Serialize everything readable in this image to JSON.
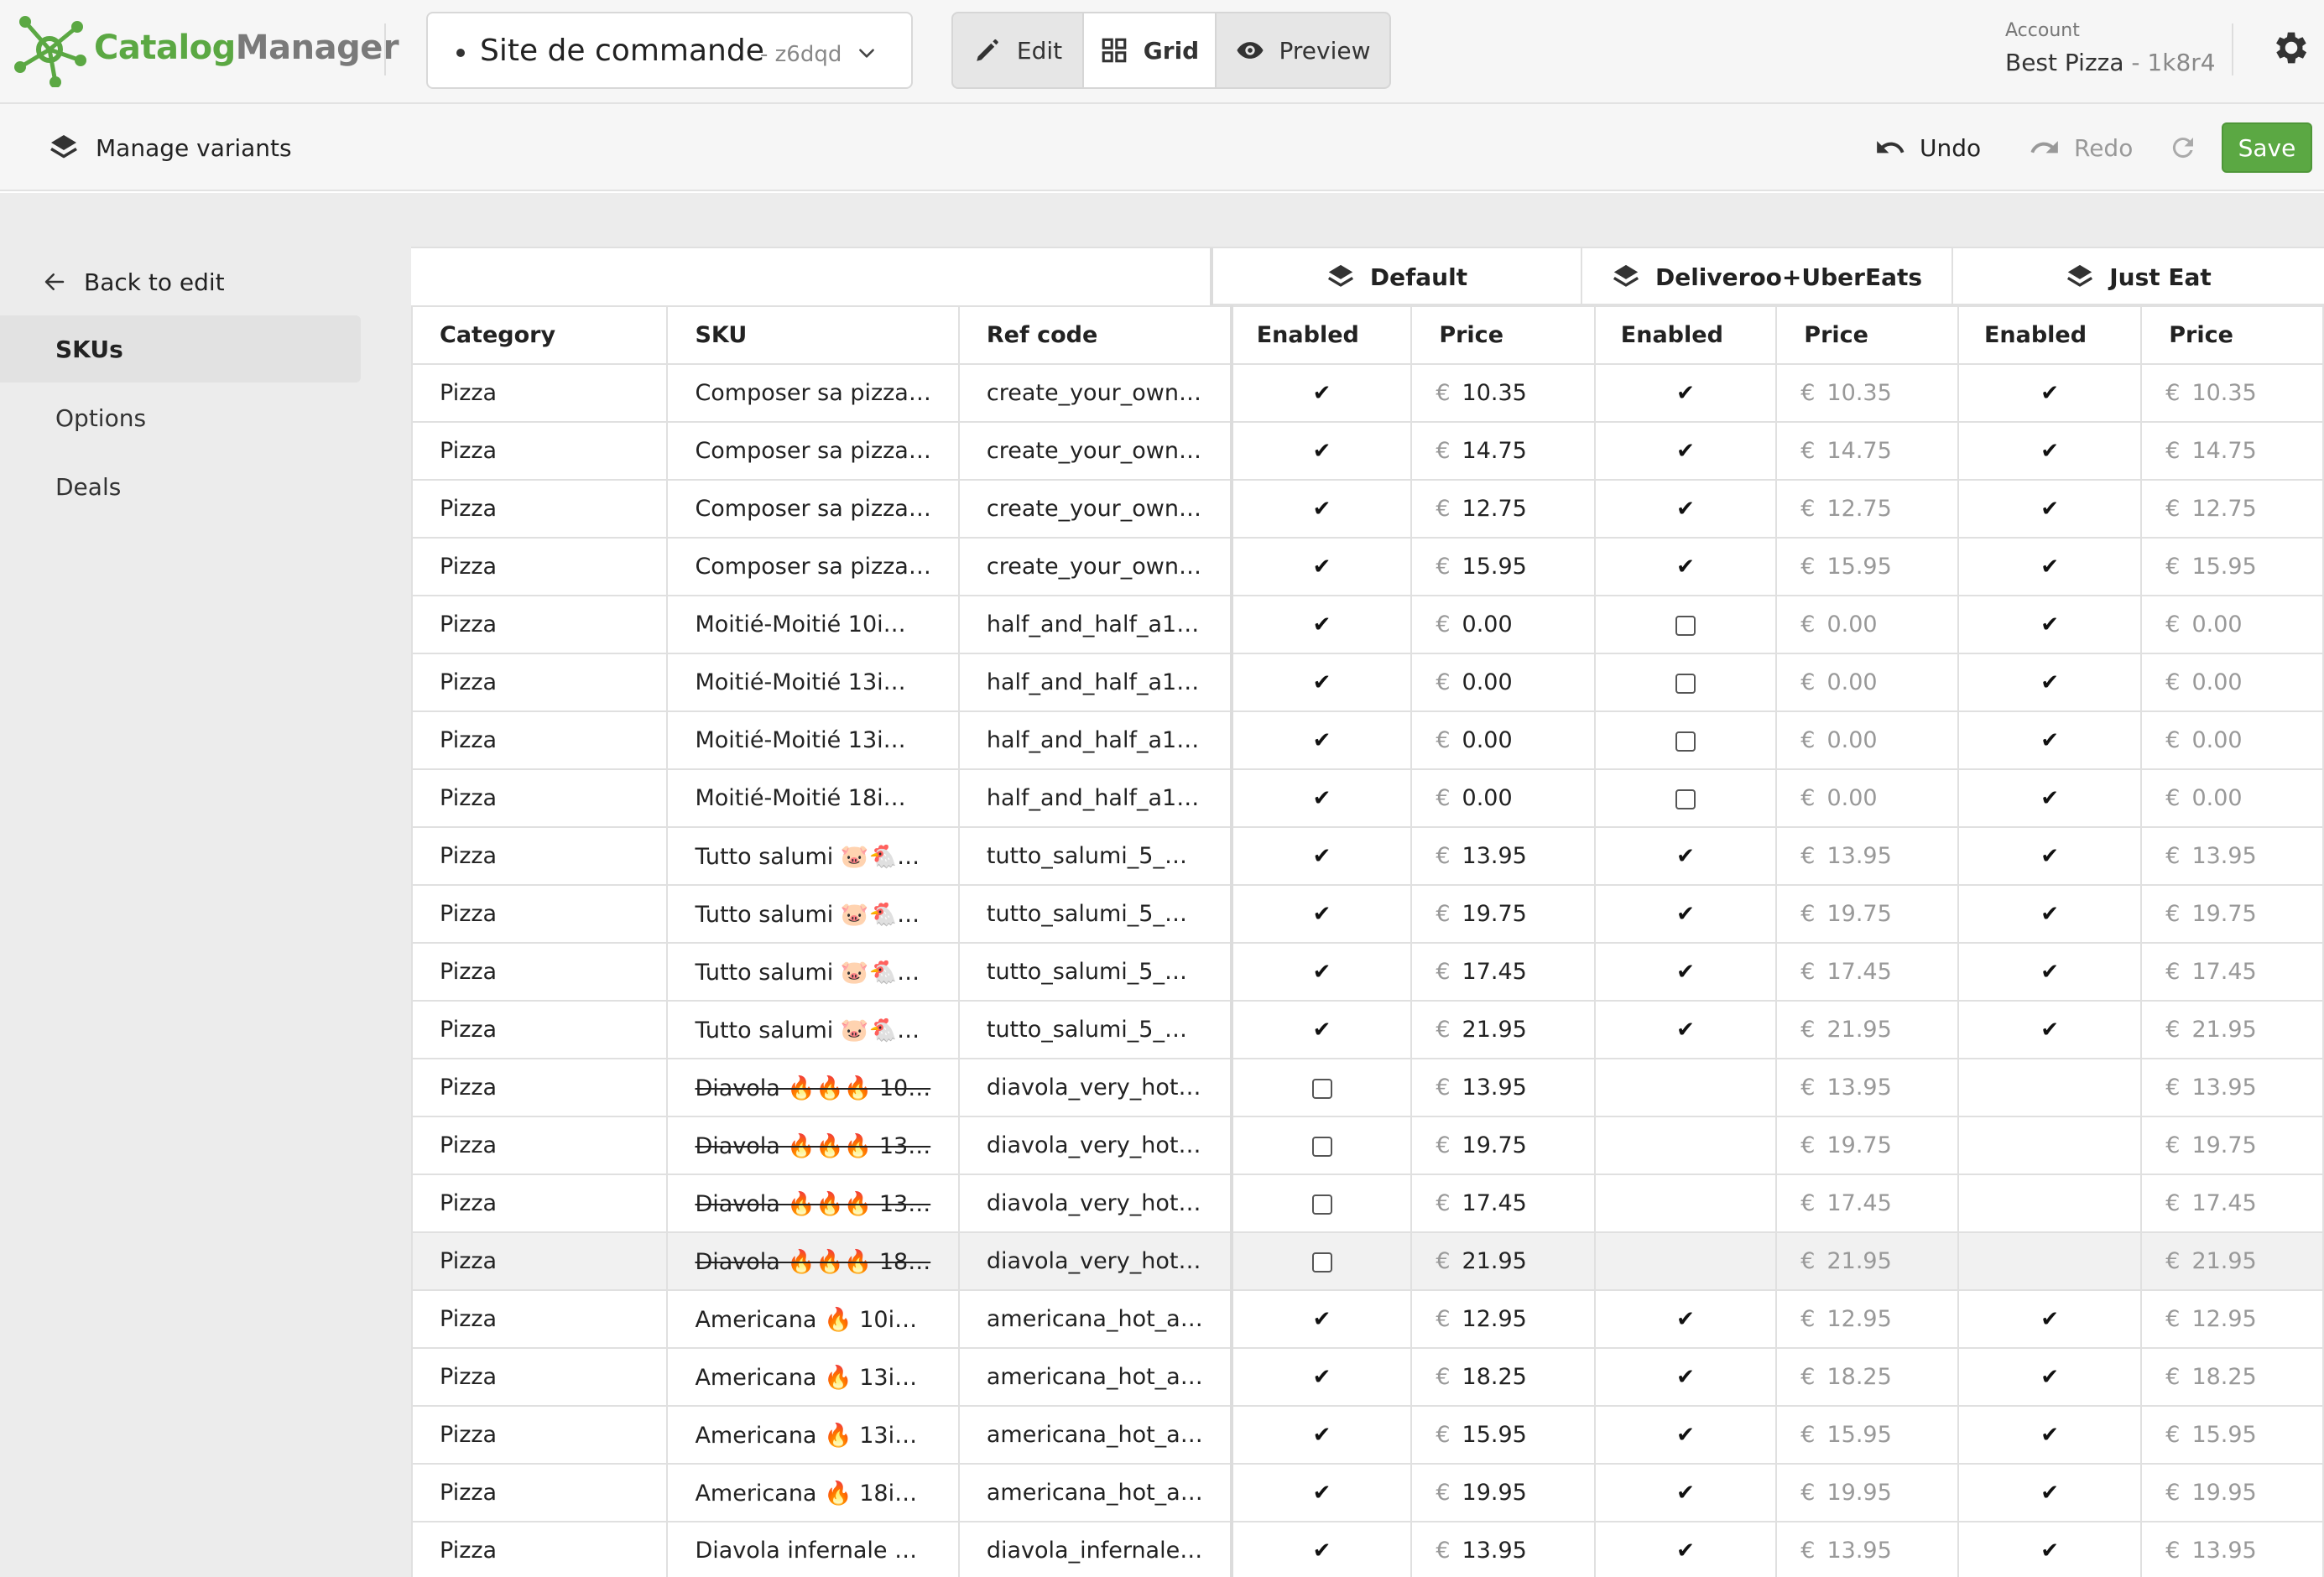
{
  "brand": {
    "part1": "Catalog",
    "part2": "Manager"
  },
  "site": {
    "name": "Site de commande",
    "code": "- z6dqd"
  },
  "modes": {
    "edit": "Edit",
    "grid": "Grid",
    "preview": "Preview"
  },
  "account": {
    "label": "Account",
    "name": "Best Pizza",
    "code": "- 1k8r4"
  },
  "toolbar": {
    "manage_variants": "Manage variants",
    "undo": "Undo",
    "redo": "Redo",
    "save": "Save"
  },
  "sidenav": {
    "back": "Back to edit",
    "items": [
      "SKUs",
      "Options",
      "Deals"
    ]
  },
  "variants": [
    "Default",
    "Deliveroo+UberEats",
    "Just Eat"
  ],
  "columns": {
    "category": "Category",
    "sku": "SKU",
    "ref": "Ref code",
    "enabled": "Enabled",
    "price": "Price"
  },
  "currency": "€",
  "colors": {
    "accent": "#5ba843",
    "muted": "#999999"
  },
  "rows": [
    {
      "category": "Pizza",
      "sku": "Composer sa pizza…",
      "ref": "create_your_own…",
      "strike": false,
      "d_en": "check",
      "d_price": "10.35",
      "u_en": "check",
      "u_price": "10.35",
      "j_en": "check",
      "j_price": "10.35"
    },
    {
      "category": "Pizza",
      "sku": "Composer sa pizza…",
      "ref": "create_your_own…",
      "strike": false,
      "d_en": "check",
      "d_price": "14.75",
      "u_en": "check",
      "u_price": "14.75",
      "j_en": "check",
      "j_price": "14.75"
    },
    {
      "category": "Pizza",
      "sku": "Composer sa pizza…",
      "ref": "create_your_own…",
      "strike": false,
      "d_en": "check",
      "d_price": "12.75",
      "u_en": "check",
      "u_price": "12.75",
      "j_en": "check",
      "j_price": "12.75"
    },
    {
      "category": "Pizza",
      "sku": "Composer sa pizza…",
      "ref": "create_your_own…",
      "strike": false,
      "d_en": "check",
      "d_price": "15.95",
      "u_en": "check",
      "u_price": "15.95",
      "j_en": "check",
      "j_price": "15.95"
    },
    {
      "category": "Pizza",
      "sku": "Moitié-Moitié 10i…",
      "ref": "half_and_half_a1…",
      "strike": false,
      "d_en": "check",
      "d_price": "0.00",
      "u_en": "box",
      "u_price": "0.00",
      "j_en": "check",
      "j_price": "0.00"
    },
    {
      "category": "Pizza",
      "sku": "Moitié-Moitié 13i…",
      "ref": "half_and_half_a1…",
      "strike": false,
      "d_en": "check",
      "d_price": "0.00",
      "u_en": "box",
      "u_price": "0.00",
      "j_en": "check",
      "j_price": "0.00"
    },
    {
      "category": "Pizza",
      "sku": "Moitié-Moitié 13i…",
      "ref": "half_and_half_a1…",
      "strike": false,
      "d_en": "check",
      "d_price": "0.00",
      "u_en": "box",
      "u_price": "0.00",
      "j_en": "check",
      "j_price": "0.00"
    },
    {
      "category": "Pizza",
      "sku": "Moitié-Moitié 18i…",
      "ref": "half_and_half_a1…",
      "strike": false,
      "d_en": "check",
      "d_price": "0.00",
      "u_en": "box",
      "u_price": "0.00",
      "j_en": "check",
      "j_price": "0.00"
    },
    {
      "category": "Pizza",
      "sku": "Tutto salumi 🐷🐔…",
      "ref": "tutto_salumi_5_…",
      "strike": false,
      "d_en": "check",
      "d_price": "13.95",
      "u_en": "check",
      "u_price": "13.95",
      "j_en": "check",
      "j_price": "13.95"
    },
    {
      "category": "Pizza",
      "sku": "Tutto salumi 🐷🐔…",
      "ref": "tutto_salumi_5_…",
      "strike": false,
      "d_en": "check",
      "d_price": "19.75",
      "u_en": "check",
      "u_price": "19.75",
      "j_en": "check",
      "j_price": "19.75"
    },
    {
      "category": "Pizza",
      "sku": "Tutto salumi 🐷🐔…",
      "ref": "tutto_salumi_5_…",
      "strike": false,
      "d_en": "check",
      "d_price": "17.45",
      "u_en": "check",
      "u_price": "17.45",
      "j_en": "check",
      "j_price": "17.45"
    },
    {
      "category": "Pizza",
      "sku": "Tutto salumi 🐷🐔…",
      "ref": "tutto_salumi_5_…",
      "strike": false,
      "d_en": "check",
      "d_price": "21.95",
      "u_en": "check",
      "u_price": "21.95",
      "j_en": "check",
      "j_price": "21.95"
    },
    {
      "category": "Pizza",
      "sku": "Diavola 🔥🔥🔥 10…",
      "ref": "diavola_very_hot…",
      "strike": true,
      "d_en": "box",
      "d_price": "13.95",
      "u_en": "",
      "u_price": "13.95",
      "j_en": "",
      "j_price": "13.95"
    },
    {
      "category": "Pizza",
      "sku": "Diavola 🔥🔥🔥 13…",
      "ref": "diavola_very_hot…",
      "strike": true,
      "d_en": "box",
      "d_price": "19.75",
      "u_en": "",
      "u_price": "19.75",
      "j_en": "",
      "j_price": "19.75"
    },
    {
      "category": "Pizza",
      "sku": "Diavola 🔥🔥🔥 13…",
      "ref": "diavola_very_hot…",
      "strike": true,
      "d_en": "box",
      "d_price": "17.45",
      "u_en": "",
      "u_price": "17.45",
      "j_en": "",
      "j_price": "17.45"
    },
    {
      "category": "Pizza",
      "sku": "Diavola 🔥🔥🔥 18…",
      "ref": "diavola_very_hot…",
      "strike": true,
      "d_en": "box",
      "d_price": "21.95",
      "u_en": "",
      "u_price": "21.95",
      "j_en": "",
      "j_price": "21.95",
      "hover": true
    },
    {
      "category": "Pizza",
      "sku": "Americana 🔥 10i…",
      "ref": "americana_hot_a…",
      "strike": false,
      "d_en": "check",
      "d_price": "12.95",
      "u_en": "check",
      "u_price": "12.95",
      "j_en": "check",
      "j_price": "12.95"
    },
    {
      "category": "Pizza",
      "sku": "Americana 🔥 13i…",
      "ref": "americana_hot_a…",
      "strike": false,
      "d_en": "check",
      "d_price": "18.25",
      "u_en": "check",
      "u_price": "18.25",
      "j_en": "check",
      "j_price": "18.25"
    },
    {
      "category": "Pizza",
      "sku": "Americana 🔥 13i…",
      "ref": "americana_hot_a…",
      "strike": false,
      "d_en": "check",
      "d_price": "15.95",
      "u_en": "check",
      "u_price": "15.95",
      "j_en": "check",
      "j_price": "15.95"
    },
    {
      "category": "Pizza",
      "sku": "Americana 🔥 18i…",
      "ref": "americana_hot_a…",
      "strike": false,
      "d_en": "check",
      "d_price": "19.95",
      "u_en": "check",
      "u_price": "19.95",
      "j_en": "check",
      "j_price": "19.95"
    },
    {
      "category": "Pizza",
      "sku": "Diavola infernale …",
      "ref": "diavola_infernale…",
      "strike": false,
      "d_en": "check",
      "d_price": "13.95",
      "u_en": "check",
      "u_price": "13.95",
      "j_en": "check",
      "j_price": "13.95"
    }
  ]
}
